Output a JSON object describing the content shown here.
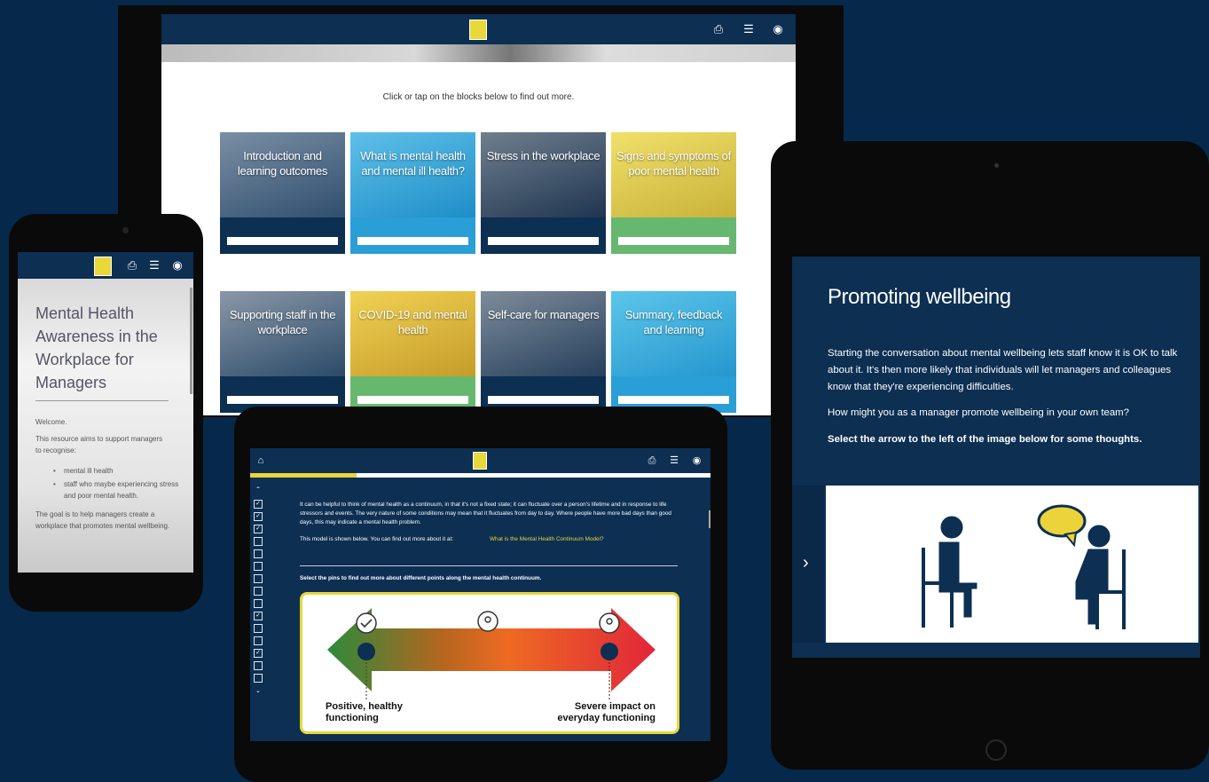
{
  "colors": {
    "background": "#06284a",
    "navy": "#0c2f52",
    "accent_yellow": "#ecd33a"
  },
  "icons": {
    "print": "printer-icon",
    "menu": "menu-icon",
    "accessibility": "eye-icon",
    "home": "home-icon",
    "next": "chevron-right-icon"
  },
  "laptop": {
    "intro": "Click or tap on the blocks below to find out more.",
    "tiles": [
      {
        "title": "Introduction and learning outcomes",
        "color": "#0c2f52"
      },
      {
        "title": "What is mental health and mental ill health?",
        "color": "#2a9ed6"
      },
      {
        "title": "Stress in the workplace",
        "color": "#0c2f52"
      },
      {
        "title": "Signs and symptoms of poor mental health",
        "color": "#67b86f"
      },
      {
        "title": "Supporting staff in the workplace",
        "color": "#0c2f52"
      },
      {
        "title": "COVID-19 and mental health",
        "color": "#67b86f"
      },
      {
        "title": "Self-care for managers",
        "color": "#0c2f52"
      },
      {
        "title": "Summary, feedback and learning",
        "color": "#2a9ed6"
      }
    ]
  },
  "phone": {
    "title": "Mental Health Awareness in the Workplace for Managers",
    "welcome": "Welcome.",
    "aim": "This resource aims to support managers to recognise:",
    "bullets": [
      "mental ill health",
      "staff who maybe experiencing stress and poor mental health."
    ],
    "goal": "The goal is to help managers create a workplace that promotes mental wellbeing."
  },
  "tablet_bottom": {
    "para1": "It can be helpful to think of mental health as a continuum, in that it's not a fixed state; it can fluctuate over a person's lifetime and in response to life stressors and events. The very nature of some conditions may mean that it fluctuates from day to day. Where people have more bad days than good days, this may indicate a mental health problem.",
    "para2": "This model is shown below. You can find out more about it at:",
    "link": "What is the Mental Health Continuum Model?",
    "instruction": "Select the pins to find out more about different points along the mental health continuum.",
    "left_label": "Positive, healthy functioning",
    "right_label": "Severe impact on everyday functioning",
    "checklist": [
      true,
      true,
      true,
      false,
      false,
      false,
      false,
      false,
      false,
      true,
      false,
      false,
      true,
      false,
      false
    ]
  },
  "tablet_right": {
    "title": "Promoting wellbeing",
    "p1": "Starting the conversation about mental wellbeing lets staff know it is OK to talk about it. It's then more likely that individuals will let managers and colleagues know that they're experiencing difficulties.",
    "p2": "How might you as a manager promote wellbeing in your own team?",
    "p3": "Select the arrow to the left of the image below for some thoughts."
  }
}
